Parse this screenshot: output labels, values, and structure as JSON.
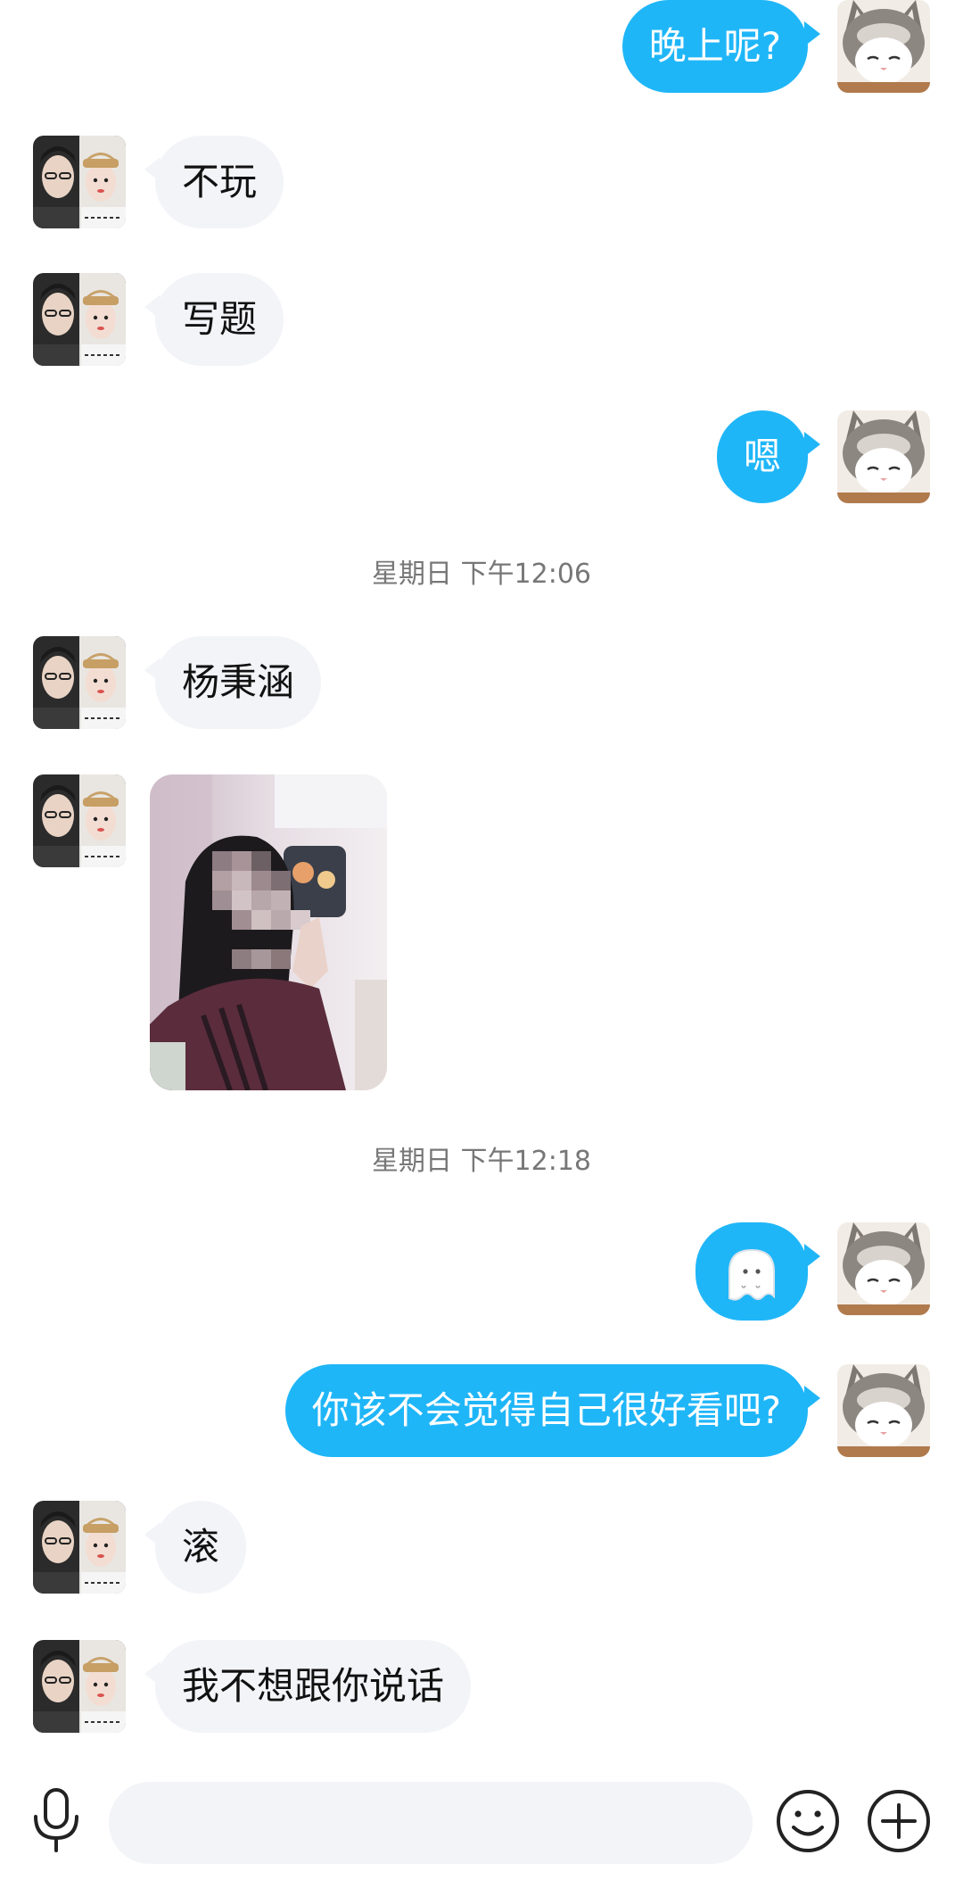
{
  "messages": [
    {
      "side": "out",
      "text": "晚上呢?"
    },
    {
      "side": "in",
      "text": "不玩"
    },
    {
      "side": "in",
      "text": "写题"
    },
    {
      "side": "out",
      "text": "嗯"
    },
    {
      "timestamp": "星期日 下午12:06"
    },
    {
      "side": "in",
      "text": "杨秉涵"
    },
    {
      "side": "in",
      "type": "photo"
    },
    {
      "timestamp": "星期日 下午12:18"
    },
    {
      "side": "out",
      "type": "sticker",
      "icon": "ghost-sticker-icon"
    },
    {
      "side": "out",
      "text": "你该不会觉得自己很好看吧?"
    },
    {
      "side": "in",
      "text": "滚"
    },
    {
      "side": "in",
      "text": "我不想跟你说话"
    }
  ],
  "input": {
    "placeholder": "",
    "value": ""
  },
  "icons": {
    "mic": "microphone-icon",
    "emoji": "smiley-icon",
    "plus": "plus-circle-icon"
  },
  "colors": {
    "outgoing_bubble": "#1fb6f8",
    "incoming_bubble": "#f3f4f8",
    "background": "#ffffff",
    "timestamp_text": "#777777"
  }
}
